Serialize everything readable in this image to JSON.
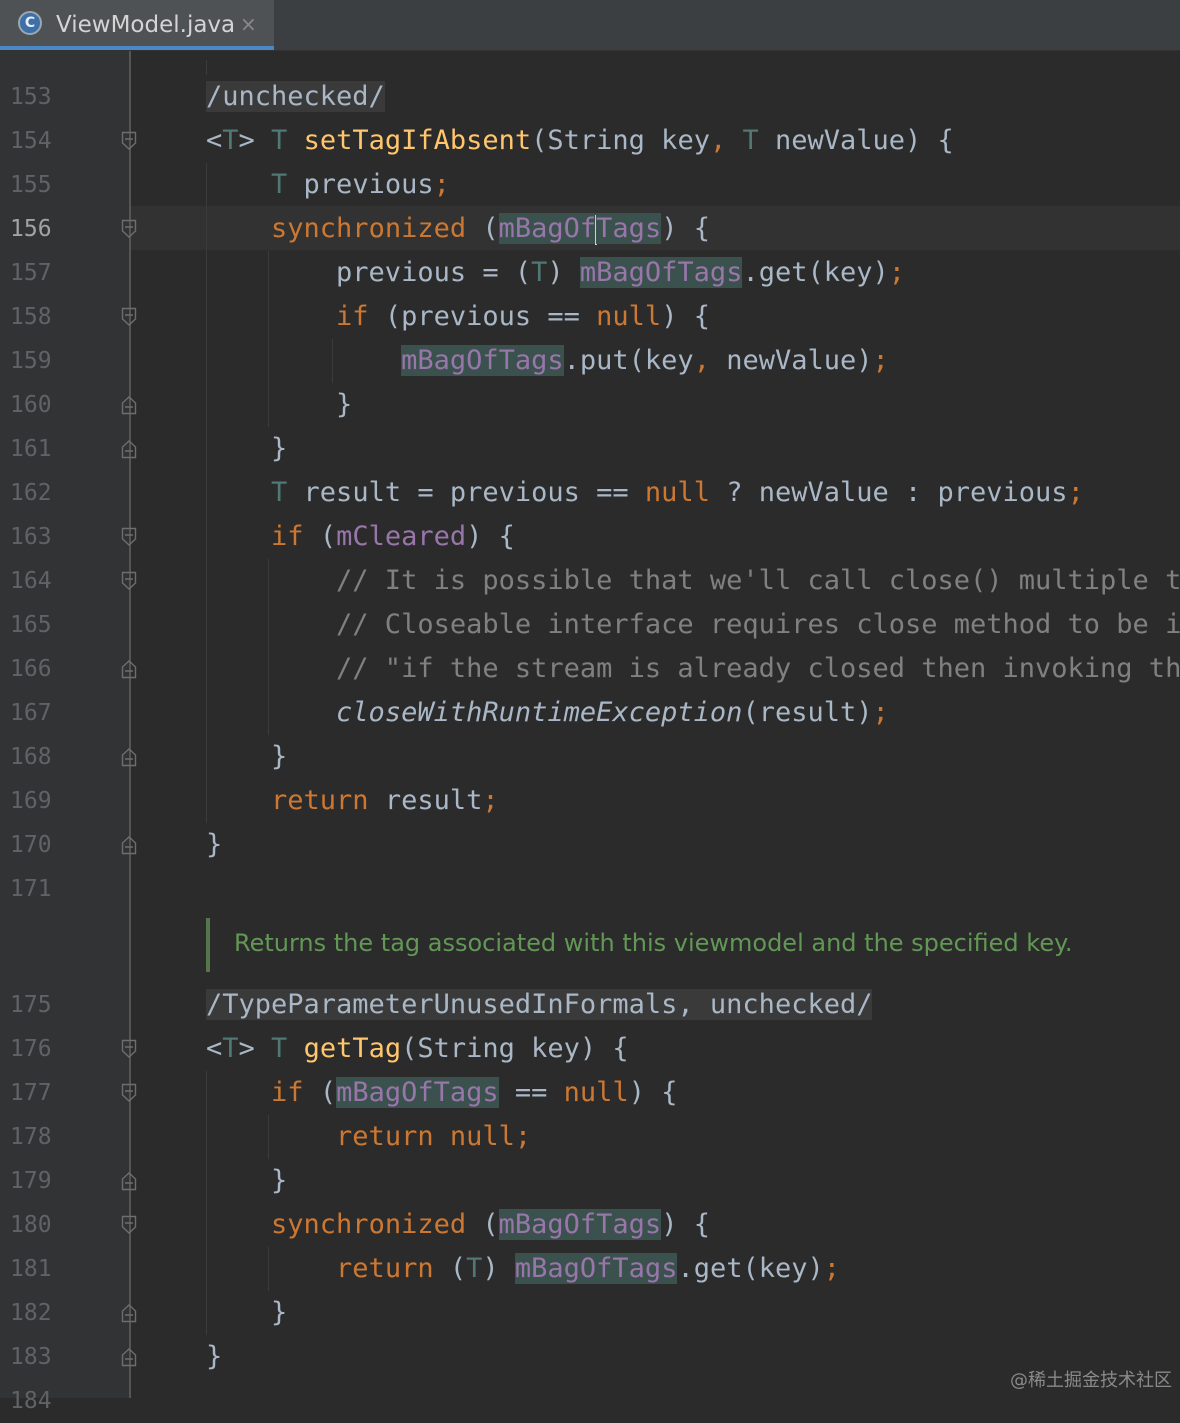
{
  "tab": {
    "icon_letter": "C",
    "label": "ViewModel.java",
    "close": "×"
  },
  "editor": {
    "current_line": "156",
    "doc_comment": "Returns the tag associated with this viewmodel and the specified key.",
    "watermark": "@稀土掘金技术社区",
    "colors": {
      "keyword": "#cc7832",
      "type_param": "#507874",
      "method": "#ffc66d",
      "field": "#9876aa",
      "comment": "#808080",
      "doc": "#629755",
      "plain": "#a9b7c6"
    },
    "lines": [
      {
        "num": "153",
        "fold": "",
        "tokens": [
          {
            "t": "/unchecked/",
            "c": "ann"
          }
        ]
      },
      {
        "num": "154",
        "fold": "open",
        "tokens": [
          {
            "t": "<",
            "c": "pl"
          },
          {
            "t": "T",
            "c": "tp"
          },
          {
            "t": "> ",
            "c": "pl"
          },
          {
            "t": "T ",
            "c": "tp"
          },
          {
            "t": "setTagIfAbsent",
            "c": "fn"
          },
          {
            "t": "(String key",
            "c": "pl"
          },
          {
            "t": ", ",
            "c": "kw"
          },
          {
            "t": "T ",
            "c": "tp"
          },
          {
            "t": "newValue) {",
            "c": "pl"
          }
        ]
      },
      {
        "num": "155",
        "fold": "",
        "tokens": [
          {
            "t": "    ",
            "c": "pl"
          },
          {
            "t": "T ",
            "c": "tp"
          },
          {
            "t": "previous",
            "c": "pl"
          },
          {
            "t": ";",
            "c": "kw"
          }
        ]
      },
      {
        "num": "156",
        "fold": "open",
        "tokens": [
          {
            "t": "    ",
            "c": "pl"
          },
          {
            "t": "synchronized ",
            "c": "kw"
          },
          {
            "t": "(",
            "c": "pl"
          },
          {
            "t": "mBagOf",
            "c": "fld"
          },
          {
            "t": "",
            "c": "caret"
          },
          {
            "t": "Tags",
            "c": "fld"
          },
          {
            "t": ") {",
            "c": "pl"
          }
        ]
      },
      {
        "num": "157",
        "fold": "",
        "tokens": [
          {
            "t": "        previous = (",
            "c": "pl"
          },
          {
            "t": "T",
            "c": "tp"
          },
          {
            "t": ") ",
            "c": "pl"
          },
          {
            "t": "mBagOfTags",
            "c": "fld"
          },
          {
            "t": ".get(key)",
            "c": "pl"
          },
          {
            "t": ";",
            "c": "kw"
          }
        ]
      },
      {
        "num": "158",
        "fold": "open",
        "tokens": [
          {
            "t": "        ",
            "c": "pl"
          },
          {
            "t": "if ",
            "c": "kw"
          },
          {
            "t": "(previous == ",
            "c": "pl"
          },
          {
            "t": "null",
            "c": "kw"
          },
          {
            "t": ") {",
            "c": "pl"
          }
        ]
      },
      {
        "num": "159",
        "fold": "",
        "tokens": [
          {
            "t": "            ",
            "c": "pl"
          },
          {
            "t": "mBagOfTags",
            "c": "fld"
          },
          {
            "t": ".put(key",
            "c": "pl"
          },
          {
            "t": ", ",
            "c": "kw"
          },
          {
            "t": "newValue)",
            "c": "pl"
          },
          {
            "t": ";",
            "c": "kw"
          }
        ]
      },
      {
        "num": "160",
        "fold": "close",
        "tokens": [
          {
            "t": "        }",
            "c": "pl"
          }
        ]
      },
      {
        "num": "161",
        "fold": "close",
        "tokens": [
          {
            "t": "    }",
            "c": "pl"
          }
        ]
      },
      {
        "num": "162",
        "fold": "",
        "tokens": [
          {
            "t": "    ",
            "c": "pl"
          },
          {
            "t": "T ",
            "c": "tp"
          },
          {
            "t": "result = previous == ",
            "c": "pl"
          },
          {
            "t": "null ",
            "c": "kw"
          },
          {
            "t": "? newValue : previous",
            "c": "pl"
          },
          {
            "t": ";",
            "c": "kw"
          }
        ]
      },
      {
        "num": "163",
        "fold": "open",
        "tokens": [
          {
            "t": "    ",
            "c": "pl"
          },
          {
            "t": "if ",
            "c": "kw"
          },
          {
            "t": "(",
            "c": "pl"
          },
          {
            "t": "mCleared",
            "c": "fldp"
          },
          {
            "t": ") {",
            "c": "pl"
          }
        ]
      },
      {
        "num": "164",
        "fold": "open",
        "tokens": [
          {
            "t": "        // It is possible that we'll call close() multiple ti",
            "c": "cm"
          }
        ]
      },
      {
        "num": "165",
        "fold": "",
        "tokens": [
          {
            "t": "        // Closeable interface requires close method to be id",
            "c": "cm"
          }
        ]
      },
      {
        "num": "166",
        "fold": "close",
        "tokens": [
          {
            "t": "        // \"if the stream is already closed then invoking thi",
            "c": "cm"
          }
        ]
      },
      {
        "num": "167",
        "fold": "",
        "tokens": [
          {
            "t": "        ",
            "c": "pl"
          },
          {
            "t": "closeWithRuntimeException",
            "c": "it"
          },
          {
            "t": "(result)",
            "c": "pl"
          },
          {
            "t": ";",
            "c": "kw"
          }
        ]
      },
      {
        "num": "168",
        "fold": "close",
        "tokens": [
          {
            "t": "    }",
            "c": "pl"
          }
        ]
      },
      {
        "num": "169",
        "fold": "",
        "tokens": [
          {
            "t": "    ",
            "c": "pl"
          },
          {
            "t": "return ",
            "c": "kw"
          },
          {
            "t": "result",
            "c": "pl"
          },
          {
            "t": ";",
            "c": "kw"
          }
        ]
      },
      {
        "num": "170",
        "fold": "close",
        "tokens": [
          {
            "t": "}",
            "c": "pl"
          }
        ]
      },
      {
        "num": "171",
        "fold": "",
        "tokens": []
      },
      {
        "num": "175",
        "fold": "",
        "tokens": [
          {
            "t": "/TypeParameterUnusedInFormals, unchecked/",
            "c": "ann"
          }
        ]
      },
      {
        "num": "176",
        "fold": "open",
        "tokens": [
          {
            "t": "<",
            "c": "pl"
          },
          {
            "t": "T",
            "c": "tp"
          },
          {
            "t": "> ",
            "c": "pl"
          },
          {
            "t": "T ",
            "c": "tp"
          },
          {
            "t": "getTag",
            "c": "fn"
          },
          {
            "t": "(String key) {",
            "c": "pl"
          }
        ]
      },
      {
        "num": "177",
        "fold": "open",
        "tokens": [
          {
            "t": "    ",
            "c": "pl"
          },
          {
            "t": "if ",
            "c": "kw"
          },
          {
            "t": "(",
            "c": "pl"
          },
          {
            "t": "mBagOfTags",
            "c": "fld"
          },
          {
            "t": " == ",
            "c": "pl"
          },
          {
            "t": "null",
            "c": "kw"
          },
          {
            "t": ") {",
            "c": "pl"
          }
        ]
      },
      {
        "num": "178",
        "fold": "",
        "tokens": [
          {
            "t": "        ",
            "c": "pl"
          },
          {
            "t": "return null;",
            "c": "kw"
          }
        ]
      },
      {
        "num": "179",
        "fold": "close",
        "tokens": [
          {
            "t": "    }",
            "c": "pl"
          }
        ]
      },
      {
        "num": "180",
        "fold": "open",
        "tokens": [
          {
            "t": "    ",
            "c": "pl"
          },
          {
            "t": "synchronized ",
            "c": "kw"
          },
          {
            "t": "(",
            "c": "pl"
          },
          {
            "t": "mBagOfTags",
            "c": "fld"
          },
          {
            "t": ") {",
            "c": "pl"
          }
        ]
      },
      {
        "num": "181",
        "fold": "",
        "tokens": [
          {
            "t": "        ",
            "c": "pl"
          },
          {
            "t": "return ",
            "c": "kw"
          },
          {
            "t": "(",
            "c": "pl"
          },
          {
            "t": "T",
            "c": "tp"
          },
          {
            "t": ") ",
            "c": "pl"
          },
          {
            "t": "mBagOfTags",
            "c": "fld"
          },
          {
            "t": ".get(key)",
            "c": "pl"
          },
          {
            "t": ";",
            "c": "kw"
          }
        ]
      },
      {
        "num": "182",
        "fold": "close",
        "tokens": [
          {
            "t": "    }",
            "c": "pl"
          }
        ]
      },
      {
        "num": "183",
        "fold": "close",
        "tokens": [
          {
            "t": "}",
            "c": "pl"
          }
        ]
      },
      {
        "num": "184",
        "fold": "",
        "tokens": []
      }
    ]
  }
}
